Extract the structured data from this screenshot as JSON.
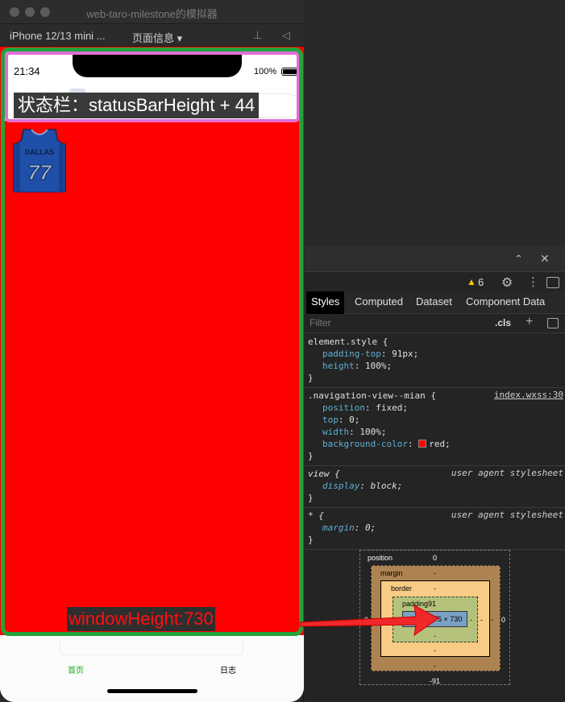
{
  "window": {
    "title": "web-taro-milestone的模拟器",
    "device": "iPhone 12/13 mini ...",
    "page_info": "页面信息 ▾"
  },
  "phone": {
    "clock": "21:34",
    "battery_pct": "100%",
    "status_label": "状态栏：statusBarHeight + 44",
    "window_label": "windowHeight:730",
    "jersey_text": "DALLAS",
    "jersey_number": "77",
    "tabs": {
      "home": "首页",
      "log": "日志"
    }
  },
  "devtools": {
    "warnings": "6",
    "tabs": [
      "Styles",
      "Computed",
      "Dataset",
      "Component Data"
    ],
    "filter_placeholder": "Filter",
    "cls": ".cls",
    "plus": "+",
    "rules": [
      {
        "selector": "element.style {",
        "source": "",
        "decls": [
          {
            "prop": "padding-top",
            "value": "91px;"
          },
          {
            "prop": "height",
            "value": "100%;"
          }
        ]
      },
      {
        "selector": ".navigation-view--mian {",
        "source": "index.wxss:30",
        "decls": [
          {
            "prop": "position",
            "value": "fixed;"
          },
          {
            "prop": "top",
            "value": "0;"
          },
          {
            "prop": "width",
            "value": "100%;"
          },
          {
            "prop": "background-color",
            "value": "red;"
          }
        ]
      },
      {
        "selector": "view {",
        "source": "user agent stylesheet",
        "decls": [
          {
            "prop": "display",
            "value": "block;"
          }
        ]
      },
      {
        "selector": "* {",
        "source": "user agent stylesheet",
        "decls": [
          {
            "prop": "margin",
            "value": "0;"
          }
        ]
      }
    ],
    "box_model": {
      "position_label": "position",
      "position_top": "0",
      "margin_label": "margin",
      "margin_top": "-",
      "border_label": "border",
      "border_top": "-",
      "padding_label": "padding91",
      "padding_side": "-",
      "content": "375 × 730",
      "margin_side": "-",
      "position_right": "0",
      "position_left": "0",
      "padding_bottom": "-",
      "border_bottom": "-",
      "margin_bottom": "-",
      "position_bottom": "-91"
    }
  },
  "colors": {
    "red_view": "#ff0000",
    "green_frame": "#23a33c",
    "pink_frame": "#e36fd6",
    "tab_active": "#1aad19"
  }
}
